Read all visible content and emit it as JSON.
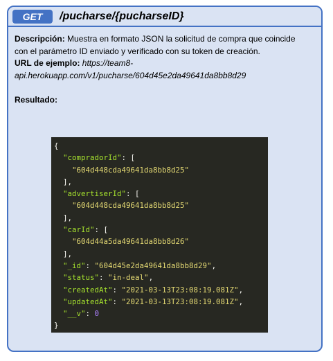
{
  "header": {
    "method": "GET",
    "endpoint": "/pucharse/{pucharseID}"
  },
  "description": {
    "label": "Descripción:",
    "text_1": " Muestra en formato JSON la solicitud de compra que coincide",
    "text_2": "con el parámetro ID enviado y verificado con su token de creación."
  },
  "example": {
    "label": "URL de ejemplo:",
    "url_1": " https://team8-",
    "url_2": "api.herokuapp.com/v1/pucharse/604d45e2da49641da8bb8d29"
  },
  "result": {
    "label": "Resultado:"
  },
  "code": {
    "open_brace": "{",
    "close_brace": "}",
    "compradorId_key": "\"compradorId\"",
    "compradorId_val": "\"604d448cda49641da8bb8d25\"",
    "advertiserId_key": "\"advertiserId\"",
    "advertiserId_val": "\"604d448cda49641da8bb8d25\"",
    "carId_key": "\"carId\"",
    "carId_val": "\"604d44a5da49641da8bb8d26\"",
    "id_key": "\"_id\"",
    "id_val": "\"604d45e2da49641da8bb8d29\"",
    "status_key": "\"status\"",
    "status_val": "\"in-deal\"",
    "createdAt_key": "\"createdAt\"",
    "createdAt_val": "\"2021-03-13T23:08:19.081Z\"",
    "updatedAt_key": "\"updatedAt\"",
    "updatedAt_val": "\"2021-03-13T23:08:19.081Z\"",
    "v_key": "\"__v\"",
    "v_val": "0"
  },
  "colors": {
    "border": "#4472c4",
    "card_bg": "#dae3f3",
    "badge_bg": "#4472c4",
    "code_bg": "#272822",
    "code_key": "#a6e22e",
    "code_string": "#e6db74",
    "code_number": "#ae81ff"
  }
}
